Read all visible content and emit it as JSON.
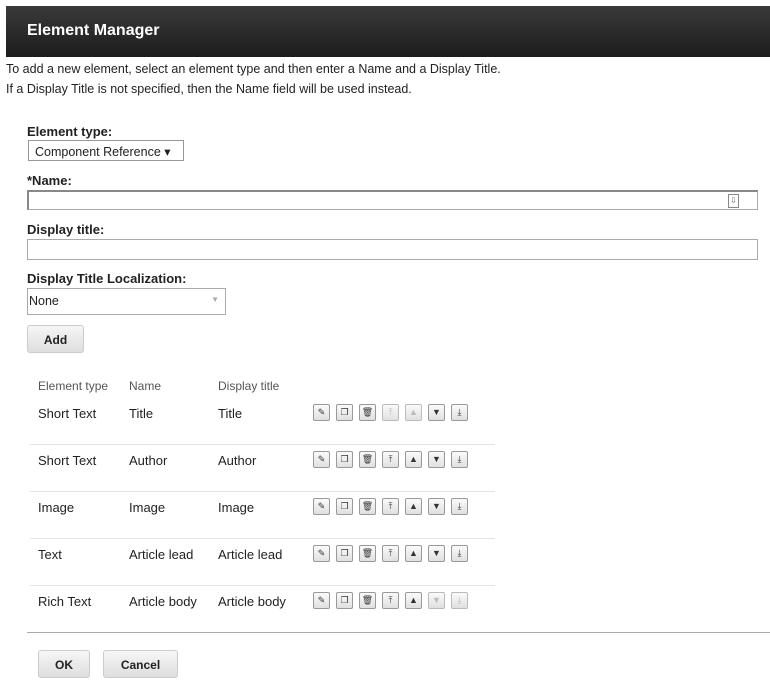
{
  "header": {
    "title": "Element Manager"
  },
  "intro": [
    "To add a new element, select an element type and then enter a Name and a Display Title.",
    "If a Display Title is not specified, then the Name field will be used instead."
  ],
  "form": {
    "element_type_label": "Element type:",
    "element_type_value": "Component Reference ▾",
    "name_label": "*Name:",
    "name_value": "",
    "display_title_label": "Display title:",
    "display_title_value": "",
    "localization_label": "Display Title Localization:",
    "localization_value": "None",
    "add_label": "Add"
  },
  "table": {
    "headers": [
      "Element type",
      "Name",
      "Display title"
    ],
    "rows": [
      {
        "type": "Short Text",
        "name": "Title",
        "title": "Title",
        "disabled": [
          "top",
          "up"
        ]
      },
      {
        "type": "Short Text",
        "name": "Author",
        "title": "Author",
        "disabled": []
      },
      {
        "type": "Image",
        "name": "Image",
        "title": "Image",
        "disabled": []
      },
      {
        "type": "Text",
        "name": "Article lead",
        "title": "Article lead",
        "disabled": []
      },
      {
        "type": "Rich Text",
        "name": "Article body",
        "title": "Article body",
        "disabled": [
          "down",
          "bottom"
        ]
      }
    ]
  },
  "footer": {
    "ok_label": "OK",
    "cancel_label": "Cancel"
  }
}
